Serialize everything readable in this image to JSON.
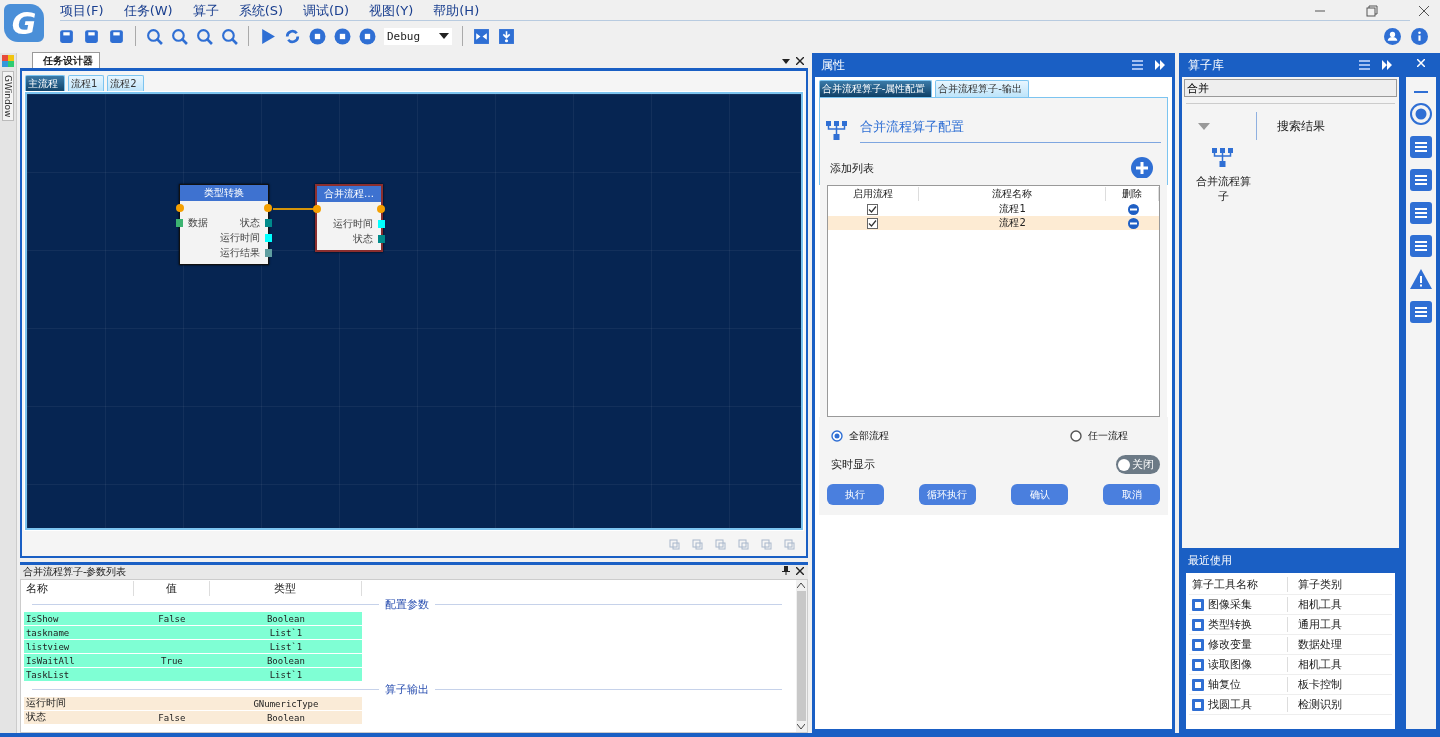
{
  "app": {
    "logo_letter": "G"
  },
  "menu": [
    "项目(F)",
    "任务(W)",
    "算子",
    "系统(S)",
    "调试(D)",
    "视图(Y)",
    "帮助(H)"
  ],
  "toolbar": {
    "config": "Debug"
  },
  "side_strip": {
    "label": "GWindow"
  },
  "designer": {
    "title": "任务设计器",
    "tabs": [
      {
        "label": "主流程",
        "selected": true
      },
      {
        "label": "流程1",
        "selected": false
      },
      {
        "label": "流程2",
        "selected": false
      }
    ],
    "nodes": [
      {
        "title": "类型转换",
        "selected": false,
        "inputs": [
          {
            "label": "数据",
            "color": "#3cb371"
          }
        ],
        "outputs": [
          {
            "label": "状态",
            "color": "#008b8b"
          },
          {
            "label": "运行时间",
            "color": "#00ffff"
          },
          {
            "label": "运行结果",
            "color": "#5f9ea0"
          }
        ]
      },
      {
        "title": "合并流程…",
        "selected": true,
        "outputs": [
          {
            "label": "运行时间",
            "color": "#00ffff"
          },
          {
            "label": "状态",
            "color": "#008b8b"
          }
        ]
      }
    ]
  },
  "params": {
    "title": "合并流程算子-参数列表",
    "columns": [
      "名称",
      "值",
      "类型"
    ],
    "sections": [
      {
        "title": "配置参数",
        "kind": "config",
        "rows": [
          [
            "IsShow",
            "False",
            "Boolean"
          ],
          [
            "taskname",
            "",
            "List`1"
          ],
          [
            "listview",
            "",
            "List`1"
          ],
          [
            "IsWaitAll",
            "True",
            "Boolean"
          ],
          [
            "TaskList",
            "",
            "List`1"
          ]
        ]
      },
      {
        "title": "算子输出",
        "kind": "output",
        "rows": [
          [
            "运行时间",
            "",
            "GNumericType"
          ],
          [
            "状态",
            "False",
            "Boolean"
          ]
        ]
      }
    ]
  },
  "properties": {
    "title": "属性",
    "tabs": [
      {
        "label": "合并流程算子-属性配置",
        "selected": true
      },
      {
        "label": "合并流程算子-输出",
        "selected": false
      }
    ],
    "heading": "合并流程算子配置",
    "list_label": "添加列表",
    "columns": [
      "启用流程",
      "流程名称",
      "删除"
    ],
    "rows": [
      {
        "enabled": true,
        "name": "流程1",
        "selected": false
      },
      {
        "enabled": true,
        "name": "流程2",
        "selected": true
      }
    ],
    "radios": [
      {
        "label": "全部流程",
        "selected": true
      },
      {
        "label": "任一流程",
        "selected": false
      }
    ],
    "realtime": {
      "label": "实时显示",
      "toggle_label": "关闭",
      "on": false
    },
    "buttons": [
      "执行",
      "循环执行",
      "确认",
      "取消"
    ]
  },
  "library": {
    "title": "算子库",
    "search": "合并",
    "results_label": "搜索结果",
    "results": [
      "合并流程算子"
    ],
    "recent": {
      "title": "最近使用",
      "columns": [
        "算子工具名称",
        "算子类别"
      ],
      "rows": [
        {
          "name": "图像采集",
          "category": "相机工具"
        },
        {
          "name": "类型转换",
          "category": "通用工具"
        },
        {
          "name": "修改变量",
          "category": "数据处理"
        },
        {
          "name": "读取图像",
          "category": "相机工具"
        },
        {
          "name": "轴复位",
          "category": "板卡控制"
        },
        {
          "name": "找圆工具",
          "category": "检测识别"
        }
      ]
    }
  }
}
